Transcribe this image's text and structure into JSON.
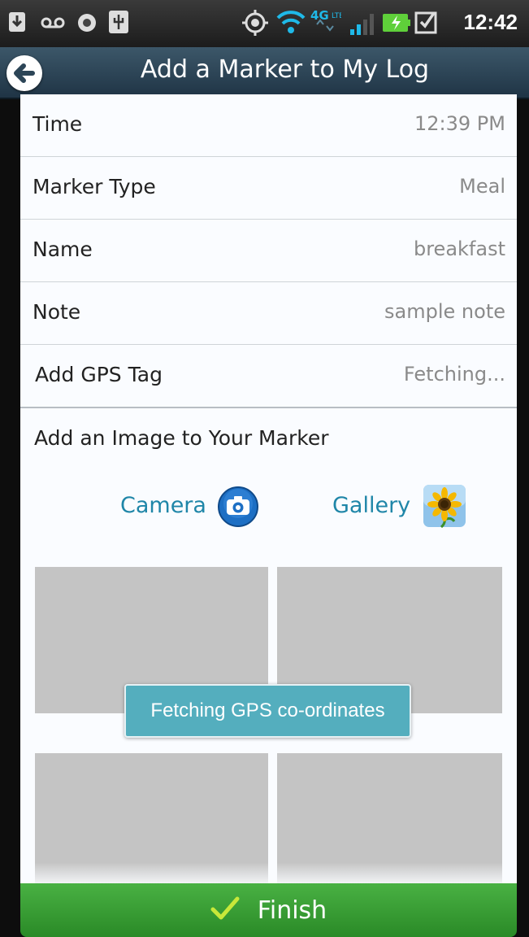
{
  "status_bar": {
    "time": "12:42",
    "icons": [
      "download-icon",
      "voicemail-icon",
      "media-icon",
      "usb-icon",
      "gps-icon",
      "wifi-icon",
      "4g-lte-icon",
      "signal-icon",
      "battery-charging-icon",
      "checkbox-icon"
    ]
  },
  "title_bar": {
    "title": "Add a Marker to My Log",
    "back_icon": "back-arrow-icon"
  },
  "form": {
    "rows": [
      {
        "label": "Time",
        "value": "12:39 PM"
      },
      {
        "label": "Marker Type",
        "value": "Meal"
      },
      {
        "label": "Name",
        "value": "breakfast"
      },
      {
        "label": "Note",
        "value": "sample note"
      },
      {
        "label": "Add GPS Tag",
        "value": "Fetching..."
      }
    ],
    "image_section_label": "Add an Image to Your Marker",
    "camera_label": "Camera",
    "gallery_label": "Gallery"
  },
  "toast": {
    "message": "Fetching GPS co-ordinates"
  },
  "footer": {
    "finish_label": "Finish"
  },
  "colors": {
    "accent": "#1f86a8",
    "finish_green": "#3a9e35",
    "title_bar": "#2c4557",
    "toast": "#54aebe"
  }
}
